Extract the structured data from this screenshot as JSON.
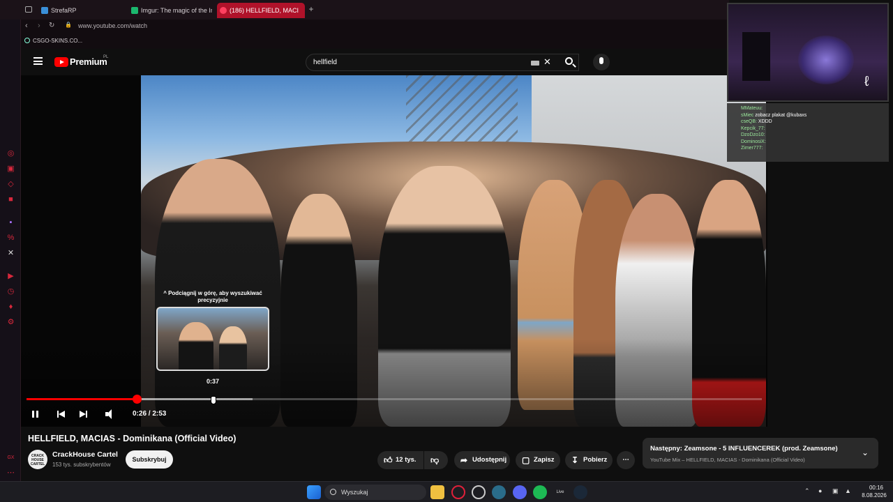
{
  "browser": {
    "tabs": [
      {
        "label": "StrefaRP"
      },
      {
        "label": "Imgur: The magic of the Int"
      },
      {
        "label": "(186) HELLFIELD, MACI"
      }
    ],
    "url": "www.youtube.com/watch",
    "bookmarks": [
      {
        "label": "CSGO-SKINS.CO..."
      }
    ],
    "sidebar_badge": "GX"
  },
  "youtube": {
    "brand": "Premium",
    "region": "PL",
    "search_value": "hellfield"
  },
  "player": {
    "preview_tip": "^ Podciągnij w górę, aby wyszukiwać precyzyjnie",
    "preview_time": "0:37",
    "time_display": "0:26 / 2:53",
    "progress_fraction": 0.15,
    "buffer_fraction": 0.307,
    "colors": {
      "progress": "#ff0000"
    }
  },
  "stream_overlay": {
    "chat": [
      {
        "user": "MMateuu:",
        "text": ""
      },
      {
        "user": "sMiec",
        "text": "zobacz plakat @kubaxs"
      },
      {
        "user": "cseQB:",
        "text": "XDDD"
      },
      {
        "user": "Kepcik_77:",
        "text": ""
      },
      {
        "user": "DzoDzo10:",
        "text": ""
      },
      {
        "user": "DominosiX:",
        "text": ""
      },
      {
        "user": "Zimer777:",
        "text": ""
      }
    ]
  },
  "video": {
    "title": "HELLFIELD, MACIAS - Dominikana (Official Video)",
    "channel": {
      "name": "CrackHouse Cartel",
      "subs": "153 tys. subskrybentów",
      "avatar_text": "CRACK HOUSE CARTEL"
    },
    "subscribe_label": "Subskrybuj",
    "actions": {
      "likes": "12 tys.",
      "share": "Udostępnij",
      "save": "Zapisz",
      "download": "Pobierz"
    }
  },
  "up_next": {
    "title": "Następny: Zeamsone - 5 INFLUENCEREK (prod. Zeamsone)",
    "subtitle": "YouTube Mix – HELLFIELD, MACIAS - Dominikana (Official Video)"
  },
  "taskbar": {
    "search_label": "Wyszukaj",
    "live_label": "Live",
    "time": "00:16",
    "date": "8.08.2026"
  }
}
